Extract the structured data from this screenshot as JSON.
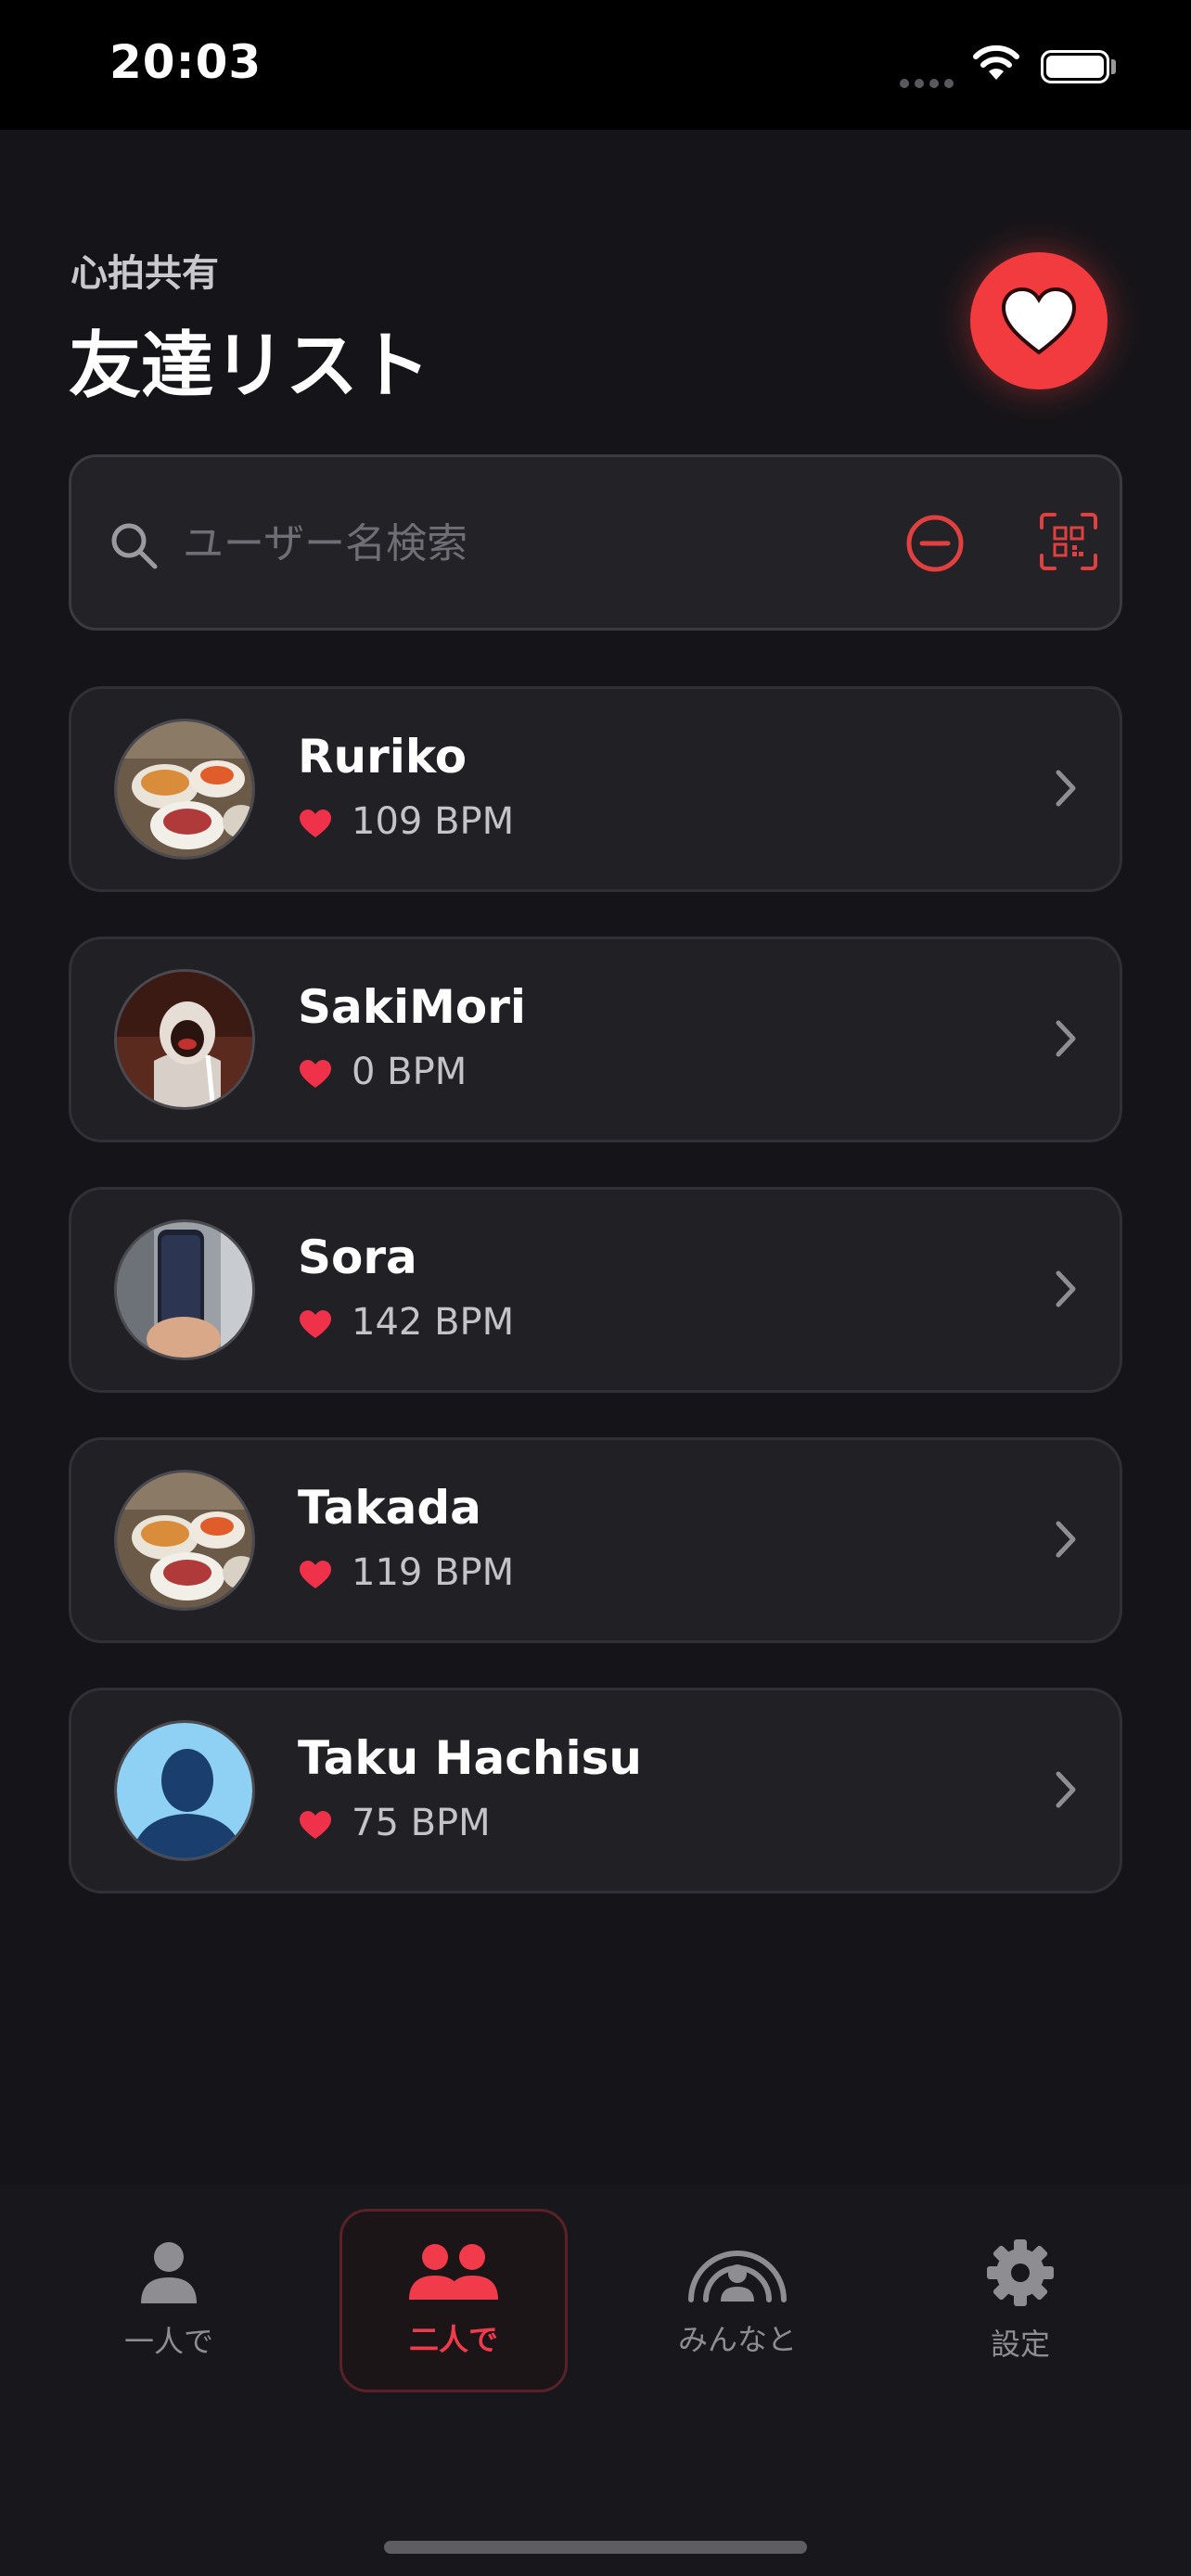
{
  "status_bar": {
    "time": "20:03"
  },
  "header": {
    "subtitle": "心拍共有",
    "title": "友達リスト"
  },
  "search": {
    "placeholder": "ユーザー名検索",
    "value": ""
  },
  "friends": [
    {
      "name": "Ruriko",
      "bpm": "109 BPM",
      "avatar": "food-photo"
    },
    {
      "name": "SakiMori",
      "bpm": "0 BPM",
      "avatar": "person-photo"
    },
    {
      "name": "Sora",
      "bpm": "142 BPM",
      "avatar": "phone-photo"
    },
    {
      "name": "Takada",
      "bpm": "119 BPM",
      "avatar": "food-photo"
    },
    {
      "name": "Taku Hachisu",
      "bpm": "75 BPM",
      "avatar": "default-silhouette"
    }
  ],
  "tabs": [
    {
      "label": "一人で",
      "icon": "person-icon"
    },
    {
      "label": "二人で",
      "icon": "two-people-icon",
      "active": true
    },
    {
      "label": "みんなと",
      "icon": "group-broadcast-icon"
    },
    {
      "label": "設定",
      "icon": "gear-icon"
    }
  ],
  "colors": {
    "accent": "#f23b3f",
    "background": "#151519",
    "card": "#202025"
  }
}
